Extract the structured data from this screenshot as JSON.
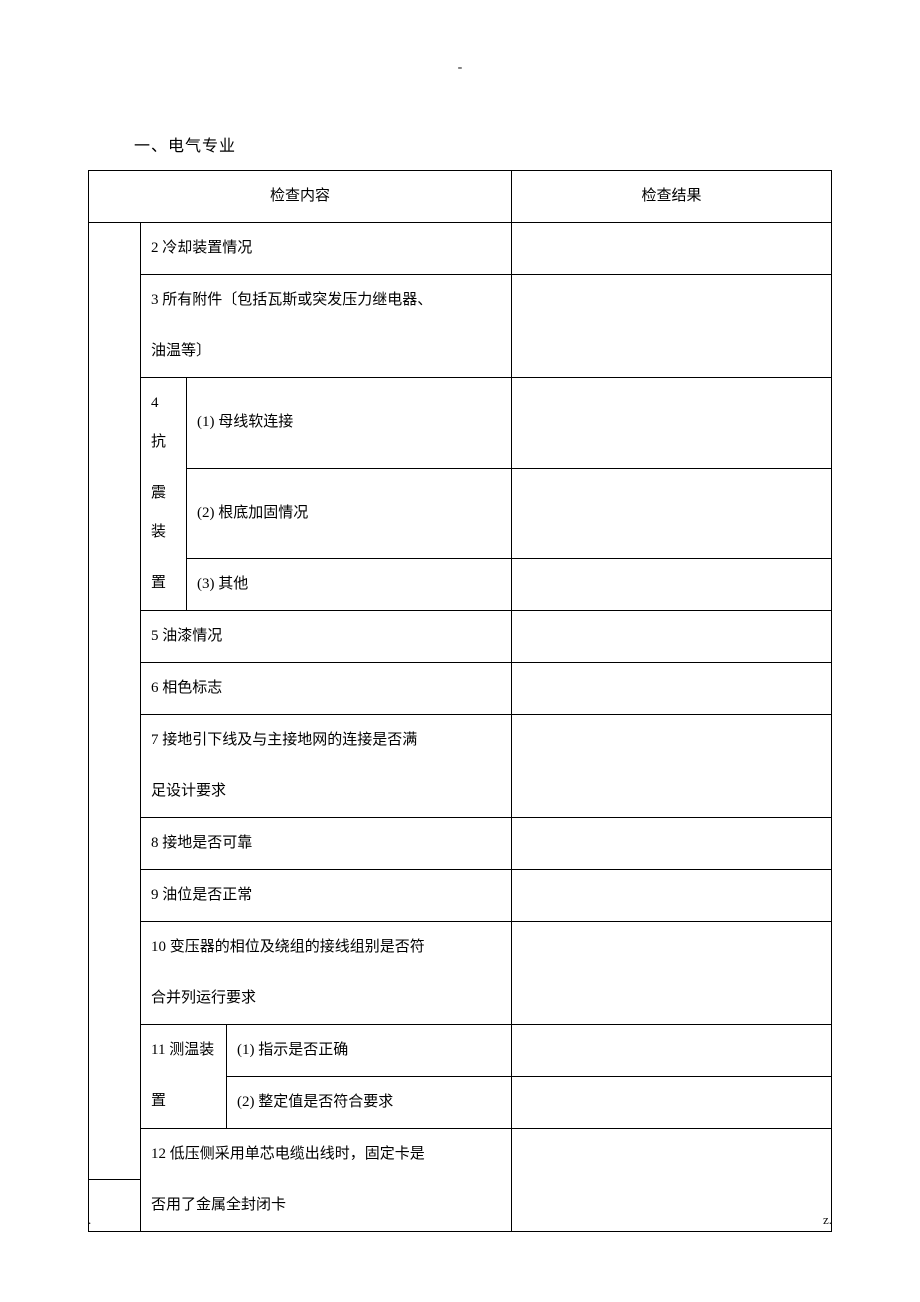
{
  "top_marker": "-",
  "section_title": "一、电气专业",
  "headers": {
    "content": "检查内容",
    "result": "检查结果"
  },
  "rows": {
    "r2": "2  冷却装置情况",
    "r3a": "3  所有附件〔包括瓦斯或突发压力继电器、",
    "r3b": "油温等〕",
    "r4_label_a": "4 抗",
    "r4_label_b": "震装",
    "r4_label_c": "置",
    "r4_1": "(1)  母线软连接",
    "r4_2": "(2)  根底加固情况",
    "r4_3": "(3)  其他",
    "r5": "5  油漆情况",
    "r6": "6  相色标志",
    "r7a": "7  接地引下线及与主接地网的连接是否满",
    "r7b": "足设计要求",
    "r8": "8  接地是否可靠",
    "r9": "9  油位是否正常",
    "r10a": "10  变压器的相位及绕组的接线组别是否符",
    "r10b": "合并列运行要求",
    "r11_label_a": "11 测温装",
    "r11_label_b": "置",
    "r11_1": "(1)  指示是否正确",
    "r11_2": "(2)  整定值是否符合要求",
    "r12a": "12  低压侧采用单芯电缆出线时，固定卡是",
    "r12b": "否用了金属全封闭卡"
  },
  "footer_left": ".",
  "footer_right": "z."
}
